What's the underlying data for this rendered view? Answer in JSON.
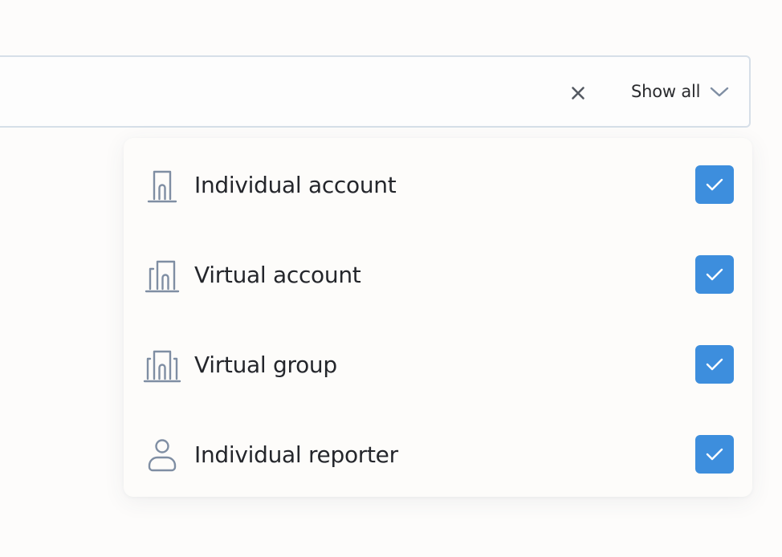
{
  "filter": {
    "clear_icon": "close-icon",
    "show_all_label": "Show all",
    "dropdown_icon": "chevron-down-icon"
  },
  "dropdown": {
    "options": [
      {
        "label": "Individual account",
        "icon": "single-building-icon",
        "checked": true
      },
      {
        "label": "Virtual account",
        "icon": "double-building-icon",
        "checked": true
      },
      {
        "label": "Virtual group",
        "icon": "triple-building-icon",
        "checked": true
      },
      {
        "label": "Individual reporter",
        "icon": "person-icon",
        "checked": true
      }
    ]
  },
  "colors": {
    "background": "#fdfcfb",
    "checkbox": "#3d8edd",
    "icon": "#7f8ea3",
    "border": "#d6dfe8",
    "text": "#24262b"
  }
}
